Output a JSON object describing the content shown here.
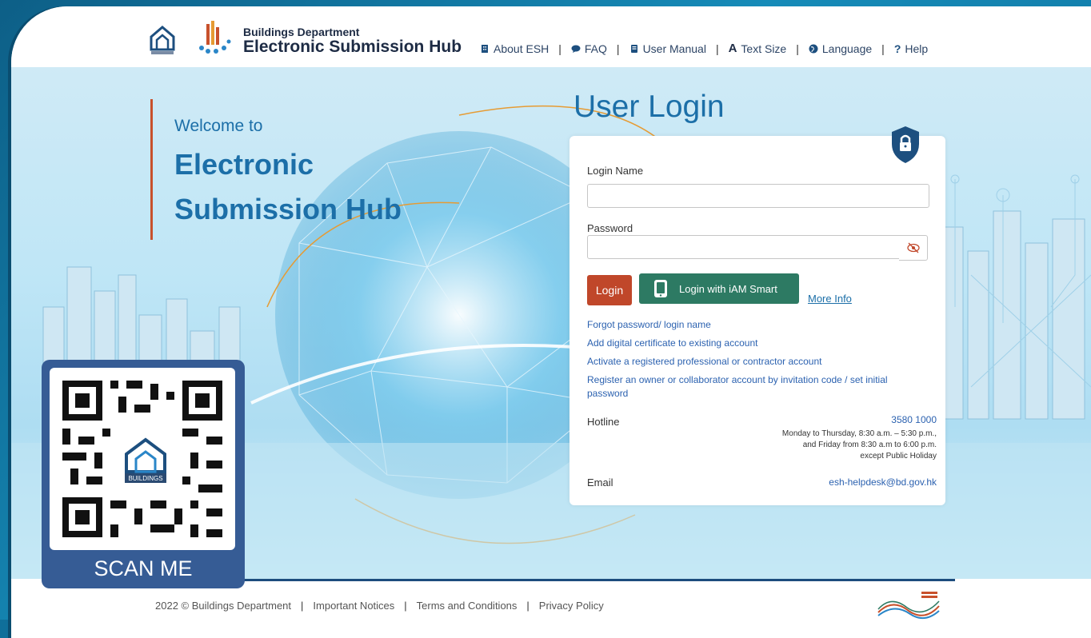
{
  "header": {
    "brand_sub": "Buildings Department",
    "brand_main": "Electronic Submission Hub",
    "nav": [
      {
        "label": "About ESH",
        "icon": "building-icon"
      },
      {
        "label": "FAQ",
        "icon": "chat-icon"
      },
      {
        "label": "User Manual",
        "icon": "book-icon"
      },
      {
        "label": "Text Size",
        "icon": "text-size-icon"
      },
      {
        "label": "Language",
        "icon": "globe-icon"
      },
      {
        "label": "Help",
        "icon": "question-icon"
      }
    ]
  },
  "hero": {
    "welcome": "Welcome to",
    "title_line1": "Electronic",
    "title_line2": "Submission Hub"
  },
  "login": {
    "title": "User Login",
    "login_name_label": "Login Name",
    "password_label": "Password",
    "login_button": "Login",
    "iam_button": "Login with iAM Smart",
    "more_info": "More Info",
    "links": [
      "Forgot password/ login name",
      "Add digital certificate to existing account",
      "Activate a registered professional or contractor account",
      "Register an owner or collaborator account by invitation code / set initial password"
    ],
    "hotline_label": "Hotline",
    "hotline_number": "3580 1000",
    "hotline_hours_1": "Monday to Thursday, 8:30 a.m. – 5:30 p.m.,",
    "hotline_hours_2": "and Friday from 8:30 a.m to 6:00 p.m.",
    "hotline_hours_3": "except Public Holiday",
    "email_label": "Email",
    "email_value": "esh-helpdesk@bd.gov.hk"
  },
  "qr": {
    "scan_label": "SCAN ME",
    "logo_text": "BUILDINGS"
  },
  "footer": {
    "copyright": "2022 © Buildings Department",
    "links": [
      "Important Notices",
      "Terms and Conditions",
      "Privacy Policy"
    ]
  },
  "colors": {
    "primary": "#1c6fa8",
    "login_button": "#c0472a",
    "iam_button": "#2d7a63",
    "qr_panel": "#365c95"
  }
}
